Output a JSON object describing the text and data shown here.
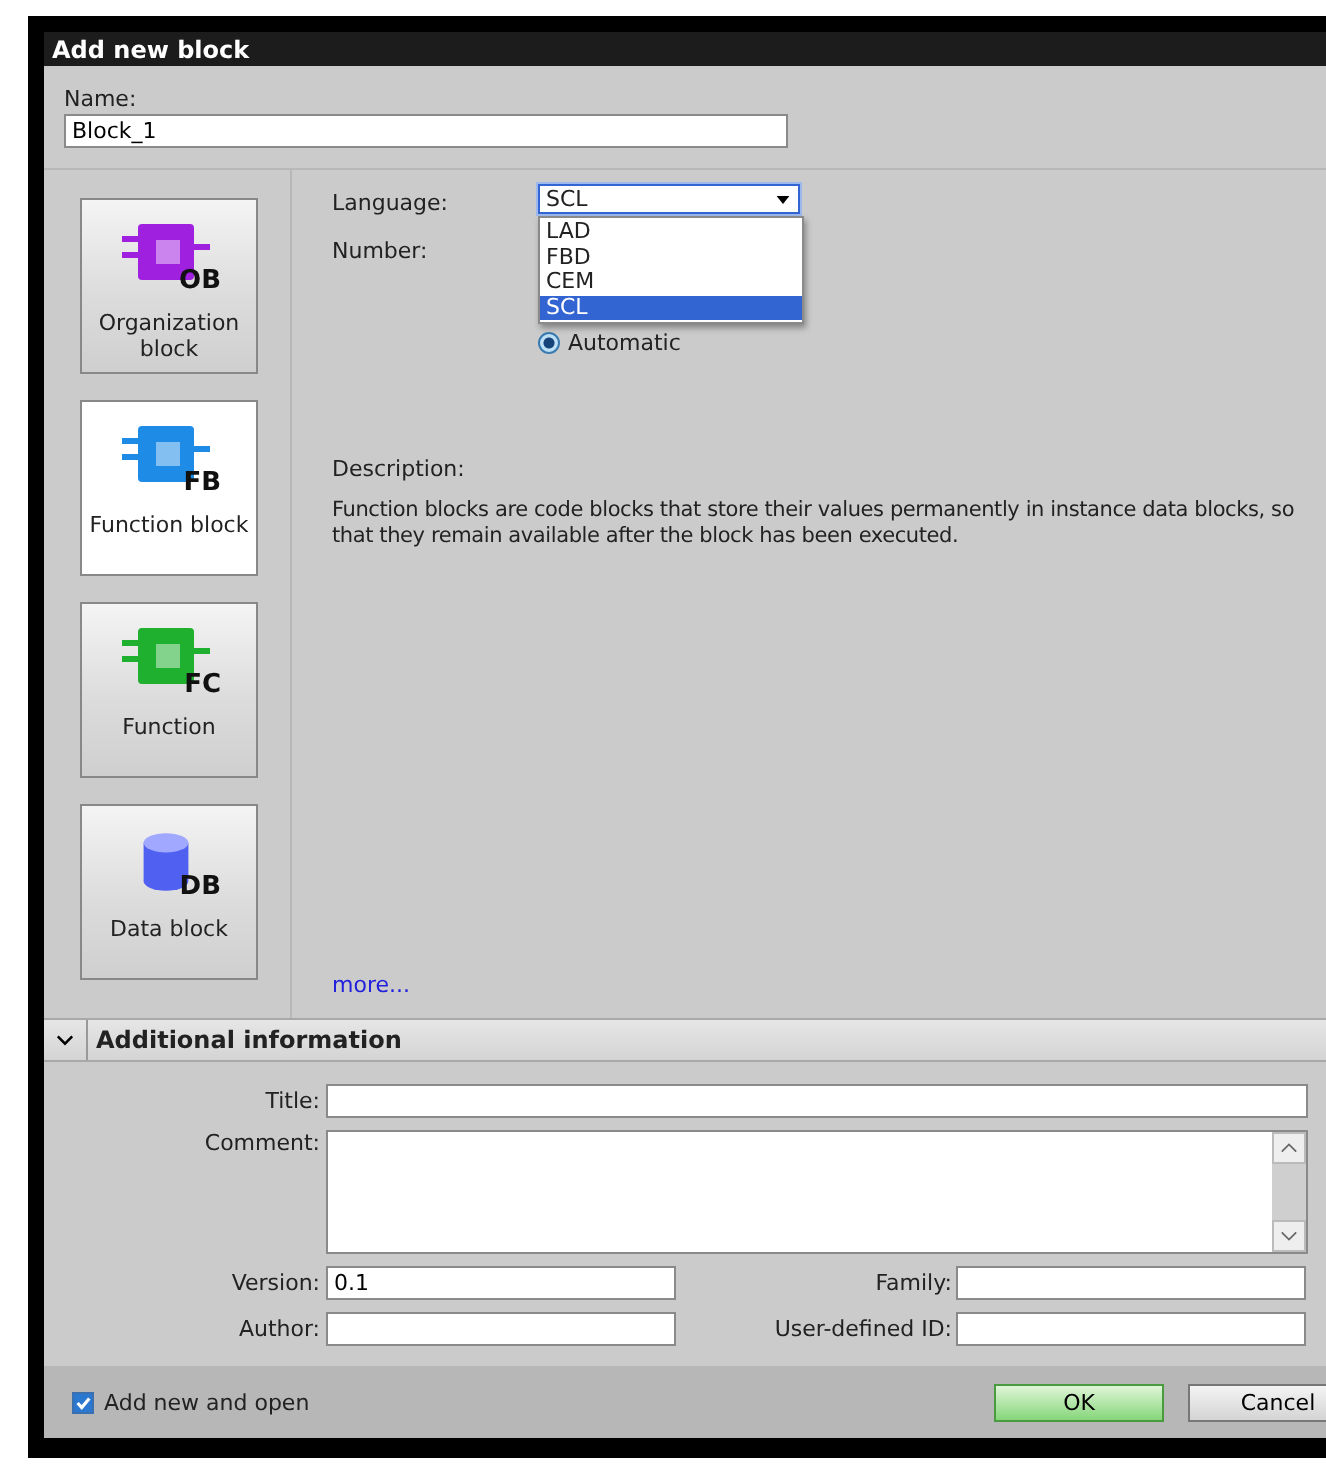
{
  "window": {
    "title": "Add new block"
  },
  "name": {
    "label": "Name:",
    "value": "Block_1"
  },
  "block_types": [
    {
      "kind": "block",
      "code": "OB",
      "label": "Organization block",
      "color": "#a020e0",
      "selected": false
    },
    {
      "kind": "block",
      "code": "FB",
      "label": "Function block",
      "color": "#1e8ce6",
      "selected": true
    },
    {
      "kind": "block",
      "code": "FC",
      "label": "Function",
      "color": "#20b030",
      "selected": false
    },
    {
      "kind": "cylinder",
      "code": "DB",
      "label": "Data block",
      "color": "#5060f0",
      "selected": false
    }
  ],
  "language": {
    "label": "Language:",
    "value": "SCL",
    "expanded": true,
    "options": [
      {
        "label": "LAD",
        "selected": false
      },
      {
        "label": "FBD",
        "selected": false
      },
      {
        "label": "CEM",
        "selected": false
      },
      {
        "label": "SCL",
        "selected": true
      }
    ]
  },
  "number": {
    "label": "Number:"
  },
  "numbering": {
    "label": "Automatic",
    "checked": true
  },
  "description": {
    "label": "Description:",
    "text": "Function blocks are code blocks that store their values permanently in instance data blocks, so that they remain available after the block has been executed."
  },
  "more_link": "more...",
  "additional_information": {
    "title": "Additional information",
    "expanded": true,
    "title_field": {
      "label": "Title:"
    },
    "comment_field": {
      "label": "Comment:"
    },
    "version": {
      "label": "Version:",
      "value": "0.1"
    },
    "family": {
      "label": "Family:"
    },
    "author": {
      "label": "Author:"
    },
    "user_defined_id": {
      "label": "User-defined ID:"
    }
  },
  "add_new_and_open": {
    "label": "Add new and open",
    "checked": true
  },
  "buttons": [
    {
      "label": "OK",
      "kind": "primary"
    },
    {
      "label": "Cancel",
      "kind": "secondary"
    }
  ]
}
